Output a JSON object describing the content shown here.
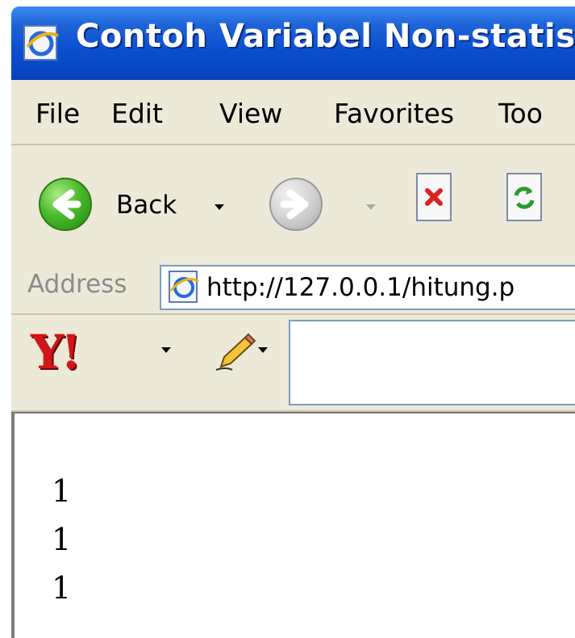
{
  "window": {
    "title": "Contoh Variabel Non-statis"
  },
  "menu": [
    "File",
    "Edit",
    "View",
    "Favorites",
    "Too"
  ],
  "toolbar": {
    "back_label": "Back"
  },
  "address": {
    "label": "Address",
    "url": "http://127.0.0.1/hitung.p"
  },
  "yahoo": {
    "logo_text": "Y!"
  },
  "content": {
    "lines": [
      "1",
      "1",
      "1"
    ]
  },
  "icons": {
    "title": "ie-page-icon",
    "back": "back-arrow-icon",
    "forward": "forward-arrow-icon",
    "stop": "stop-icon",
    "refresh": "refresh-icon",
    "address": "ie-page-icon",
    "pencil": "pencil-icon"
  },
  "colors": {
    "titlebar": "#0a4fd0",
    "chrome": "#ece9d8",
    "back_button": "#4cba2c",
    "yahoo_logo": "#d31515"
  }
}
